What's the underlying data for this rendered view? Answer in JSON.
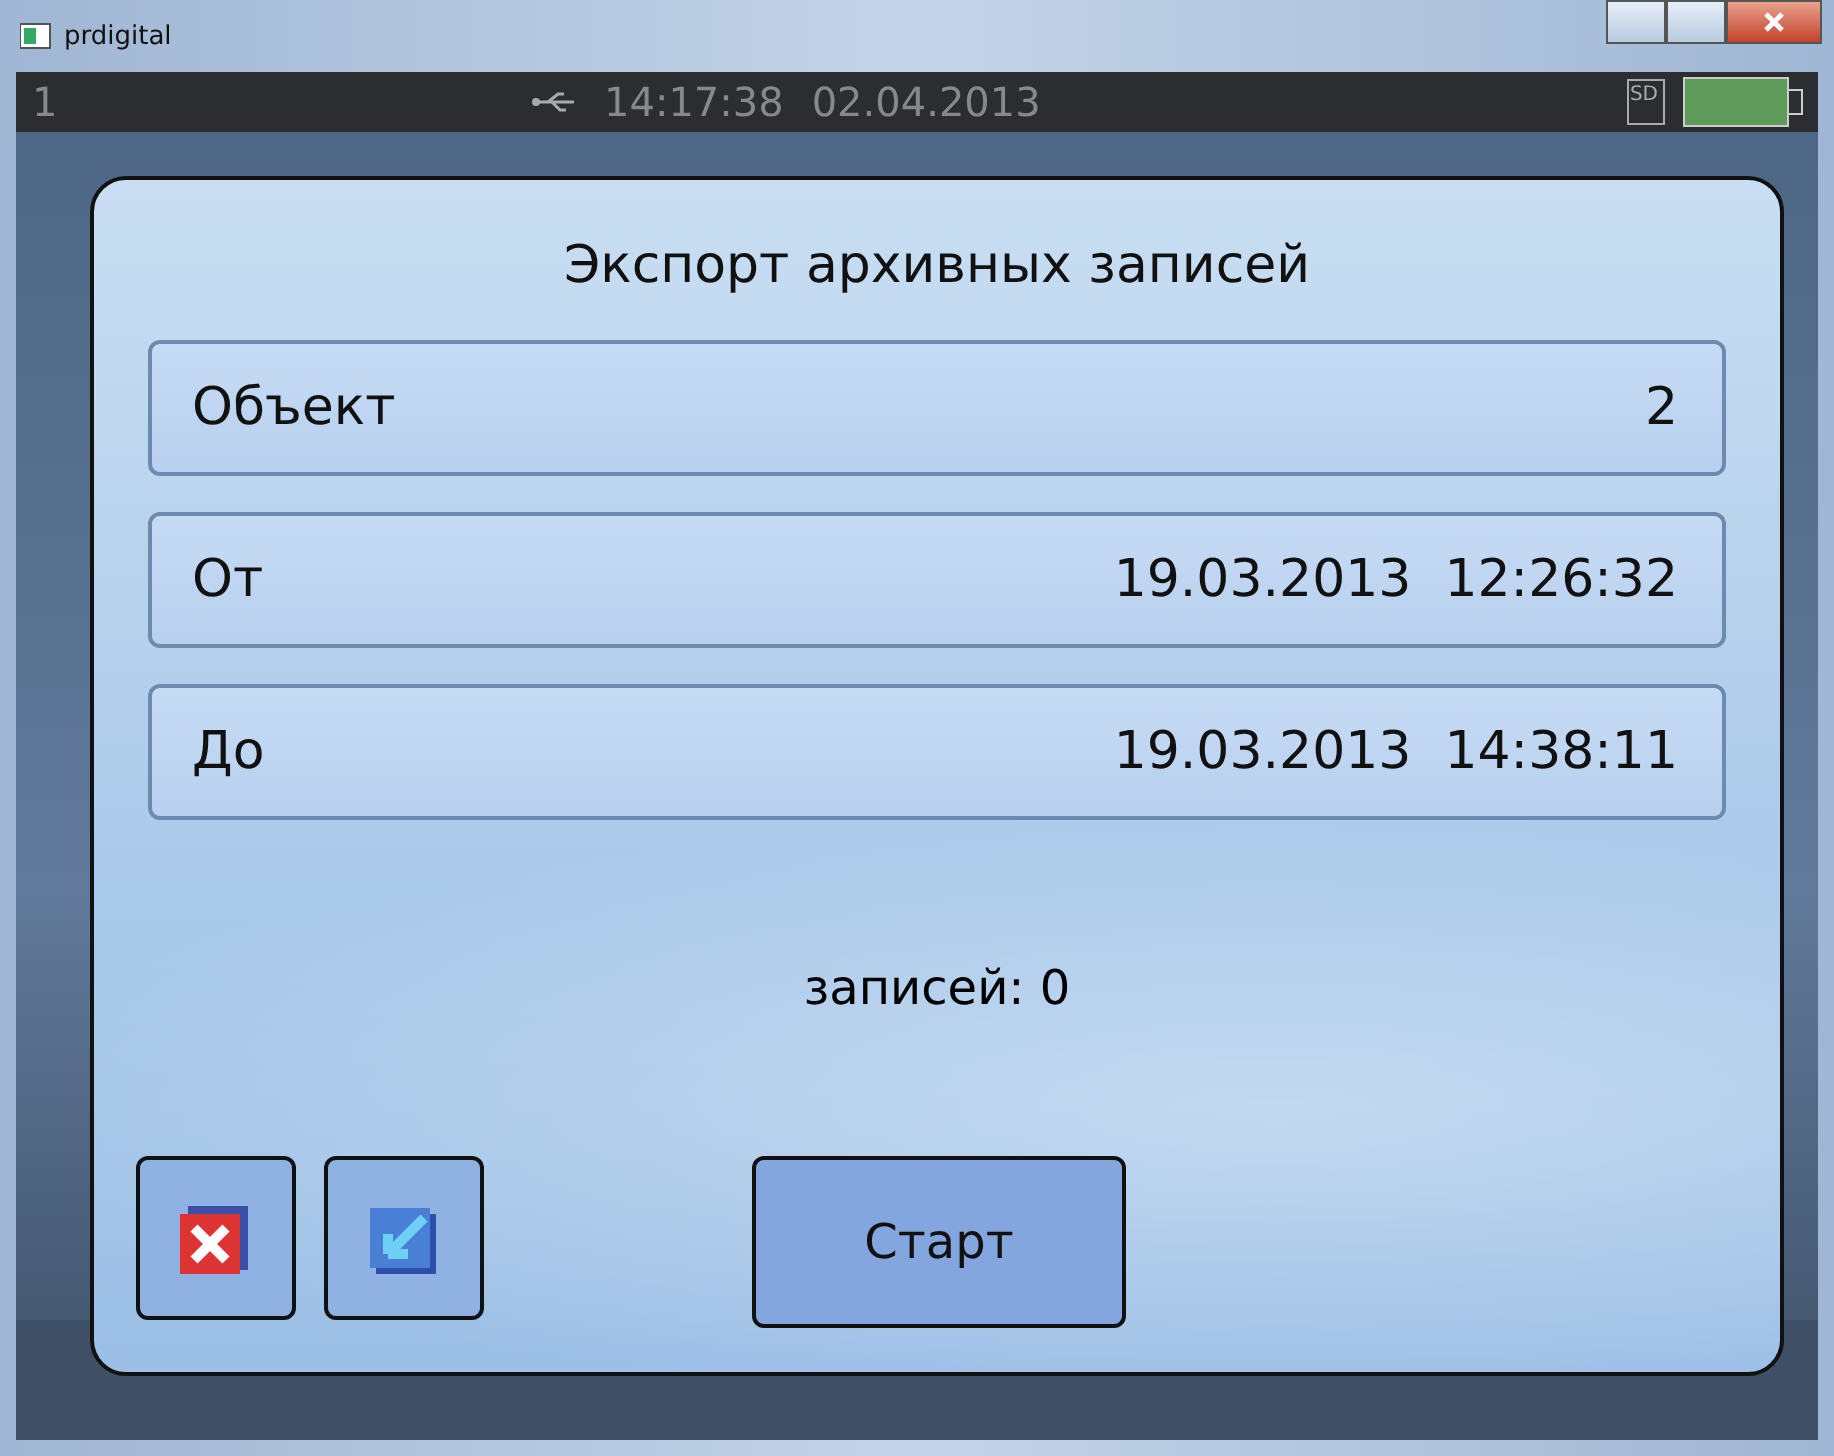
{
  "window": {
    "title": "prdigital"
  },
  "status_bar": {
    "channel": "1",
    "time": "14:17:38",
    "date": "02.04.2013",
    "storage_label": "SD"
  },
  "dialog": {
    "title": "Экспорт архивных записей",
    "fields": [
      {
        "label": "Объект",
        "value": "2"
      },
      {
        "label": "От",
        "value": "19.03.2013  12:26:32"
      },
      {
        "label": "До",
        "value": "19.03.2013  14:38:11"
      }
    ],
    "count": "записей: 0",
    "start_button": "Старт"
  }
}
